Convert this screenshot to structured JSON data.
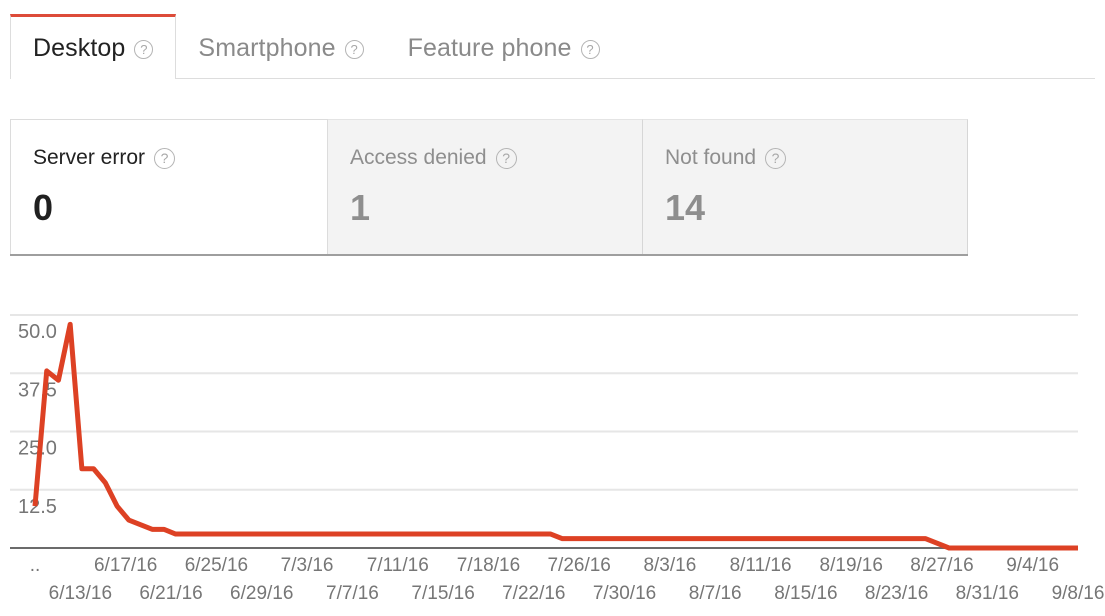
{
  "tabs": [
    {
      "label": "Desktop",
      "active": true,
      "help": "?"
    },
    {
      "label": "Smartphone",
      "active": false,
      "help": "?"
    },
    {
      "label": "Feature phone",
      "active": false,
      "help": "?"
    }
  ],
  "cards": [
    {
      "title": "Server error",
      "value": "0",
      "active": true,
      "help": "?"
    },
    {
      "title": "Access denied",
      "value": "1",
      "active": false,
      "help": "?"
    },
    {
      "title": "Not found",
      "value": "14",
      "active": false,
      "help": "?"
    }
  ],
  "colors": {
    "accent": "#dd4b39",
    "line": "#dd4124",
    "grid": "#e6e6e6",
    "axis": "#6b6b6b",
    "tick_text": "#767676",
    "inactive_text": "#8e8e8e"
  },
  "chart_data": {
    "type": "line",
    "title": "",
    "xlabel": "",
    "ylabel": "",
    "ylim": [
      0,
      56.25
    ],
    "grid": true,
    "legend": null,
    "ytick_labels": [
      "50.0",
      "37.5",
      "25.0",
      "12.5"
    ],
    "ytick_values": [
      50.0,
      37.5,
      25.0,
      12.5
    ],
    "xtick_labels_top": [
      "..",
      "6/17/16",
      "6/25/16",
      "7/3/16",
      "7/11/16",
      "7/18/16",
      "7/26/16",
      "8/3/16",
      "8/11/16",
      "8/19/16",
      "8/27/16",
      "9/4/16"
    ],
    "xtick_labels_bottom": [
      "6/13/16",
      "6/21/16",
      "6/29/16",
      "7/7/16",
      "7/15/16",
      "7/22/16",
      "7/30/16",
      "8/7/16",
      "8/15/16",
      "8/23/16",
      "8/31/16",
      "9/8/16"
    ],
    "x": [
      "6/11/16",
      "6/12/16",
      "6/13/16",
      "6/14/16",
      "6/15/16",
      "6/16/16",
      "6/17/16",
      "6/18/16",
      "6/19/16",
      "6/20/16",
      "6/21/16",
      "6/22/16",
      "6/23/16",
      "6/24/16",
      "6/25/16",
      "6/26/16",
      "6/27/16",
      "6/28/16",
      "6/29/16",
      "6/30/16",
      "7/1/16",
      "7/2/16",
      "7/3/16",
      "7/4/16",
      "7/5/16",
      "7/6/16",
      "7/7/16",
      "7/8/16",
      "7/9/16",
      "7/10/16",
      "7/11/16",
      "7/12/16",
      "7/13/16",
      "7/14/16",
      "7/15/16",
      "7/16/16",
      "7/17/16",
      "7/18/16",
      "7/19/16",
      "7/20/16",
      "7/21/16",
      "7/22/16",
      "7/23/16",
      "7/24/16",
      "7/25/16",
      "7/26/16",
      "7/27/16",
      "7/28/16",
      "7/29/16",
      "7/30/16",
      "7/31/16",
      "8/1/16",
      "8/2/16",
      "8/3/16",
      "8/4/16",
      "8/5/16",
      "8/6/16",
      "8/7/16",
      "8/8/16",
      "8/9/16",
      "8/10/16",
      "8/11/16",
      "8/12/16",
      "8/13/16",
      "8/14/16",
      "8/15/16",
      "8/16/16",
      "8/17/16",
      "8/18/16",
      "8/19/16",
      "8/20/16",
      "8/21/16",
      "8/22/16",
      "8/23/16",
      "8/24/16",
      "8/25/16",
      "8/26/16",
      "8/27/16",
      "8/28/16",
      "8/29/16",
      "8/30/16",
      "8/31/16",
      "9/1/16",
      "9/2/16",
      "9/3/16",
      "9/4/16",
      "9/5/16",
      "9/6/16",
      "9/7/16",
      "9/8/16"
    ],
    "series": [
      {
        "name": "Not found",
        "color": "#dd4124",
        "values": [
          9,
          38,
          36,
          48,
          17,
          17,
          14,
          9,
          6,
          5,
          4,
          4,
          3,
          3,
          3,
          3,
          3,
          3,
          3,
          3,
          3,
          3,
          3,
          3,
          3,
          3,
          3,
          3,
          3,
          3,
          3,
          3,
          3,
          3,
          3,
          3,
          3,
          3,
          3,
          3,
          3,
          3,
          3,
          3,
          3,
          2,
          2,
          2,
          2,
          2,
          2,
          2,
          2,
          2,
          2,
          2,
          2,
          2,
          2,
          2,
          2,
          2,
          2,
          2,
          2,
          2,
          2,
          2,
          2,
          2,
          2,
          2,
          2,
          2,
          2,
          2,
          2,
          1,
          0,
          0,
          0,
          0,
          0,
          0,
          0,
          0,
          0,
          0,
          0,
          0
        ]
      }
    ]
  }
}
